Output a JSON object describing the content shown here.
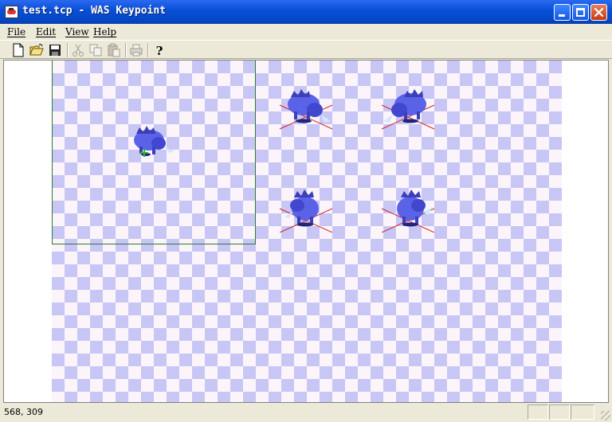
{
  "window": {
    "title": "test.tcp - WAS Keypoint",
    "controls": [
      "minimize",
      "maximize",
      "close"
    ]
  },
  "menu": [
    "File",
    "Edit",
    "View",
    "Help"
  ],
  "toolbar": {
    "buttons": [
      {
        "icon": "new-document-icon",
        "enabled": true
      },
      {
        "icon": "open-folder-icon",
        "enabled": true
      },
      {
        "icon": "save-icon",
        "enabled": true
      },
      {
        "icon": "cut-icon",
        "enabled": false
      },
      {
        "icon": "copy-icon",
        "enabled": false
      },
      {
        "icon": "paste-icon",
        "enabled": false
      },
      {
        "icon": "print-icon",
        "enabled": false
      },
      {
        "icon": "help-icon",
        "enabled": true
      }
    ]
  },
  "canvas": {
    "background": [
      "#c8c6f5",
      "#fbf5fb"
    ],
    "frame_border_color": "#2f7a2f",
    "keypoint_color": "#d42424",
    "anchor_color": "#22bb22",
    "sprite_color": "#5a62e8",
    "sprites": [
      "boar-selected",
      "boar-frame-1",
      "boar-frame-2",
      "boar-frame-3",
      "boar-frame-4"
    ]
  },
  "status": {
    "coordinates": "568, 309"
  }
}
